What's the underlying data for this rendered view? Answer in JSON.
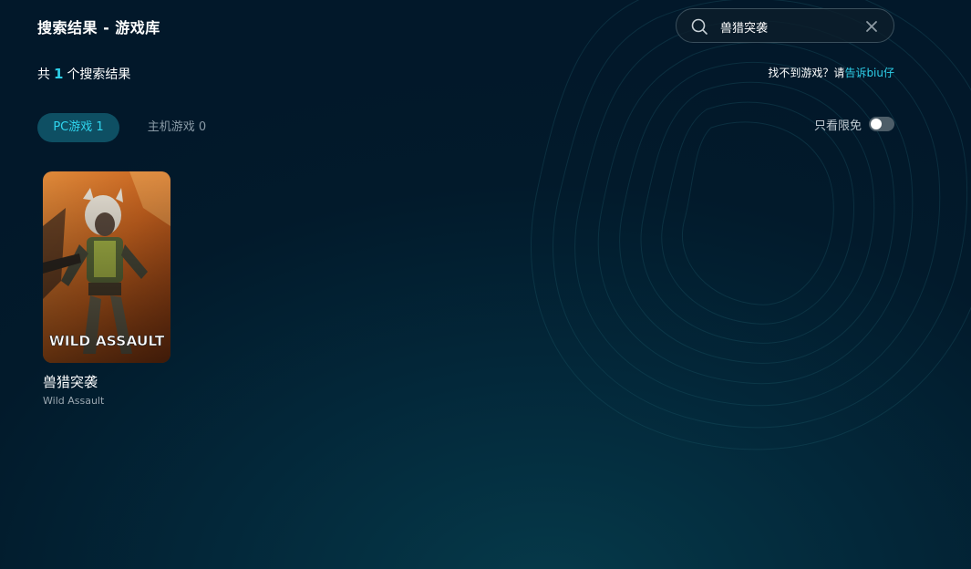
{
  "header": {
    "title": "搜索结果 - 游戏库"
  },
  "search": {
    "value": "兽猎突袭",
    "placeholder": ""
  },
  "results": {
    "prefix": "共",
    "count": "1",
    "suffix": "个搜索结果"
  },
  "missing": {
    "text": "找不到游戏？请",
    "link": "告诉biu仔"
  },
  "tabs": [
    {
      "label": "PC游戏 1",
      "active": true
    },
    {
      "label": "主机游戏 0",
      "active": false
    }
  ],
  "filter": {
    "label": "只看限免",
    "enabled": false
  },
  "games": [
    {
      "name": "兽猎突袭",
      "name_en": "Wild Assault",
      "cover_text": "WILD ASSAULT"
    }
  ],
  "colors": {
    "accent": "#2ed0ea",
    "tab_active_bg": "#0e4f63",
    "background": "#021a2b"
  }
}
